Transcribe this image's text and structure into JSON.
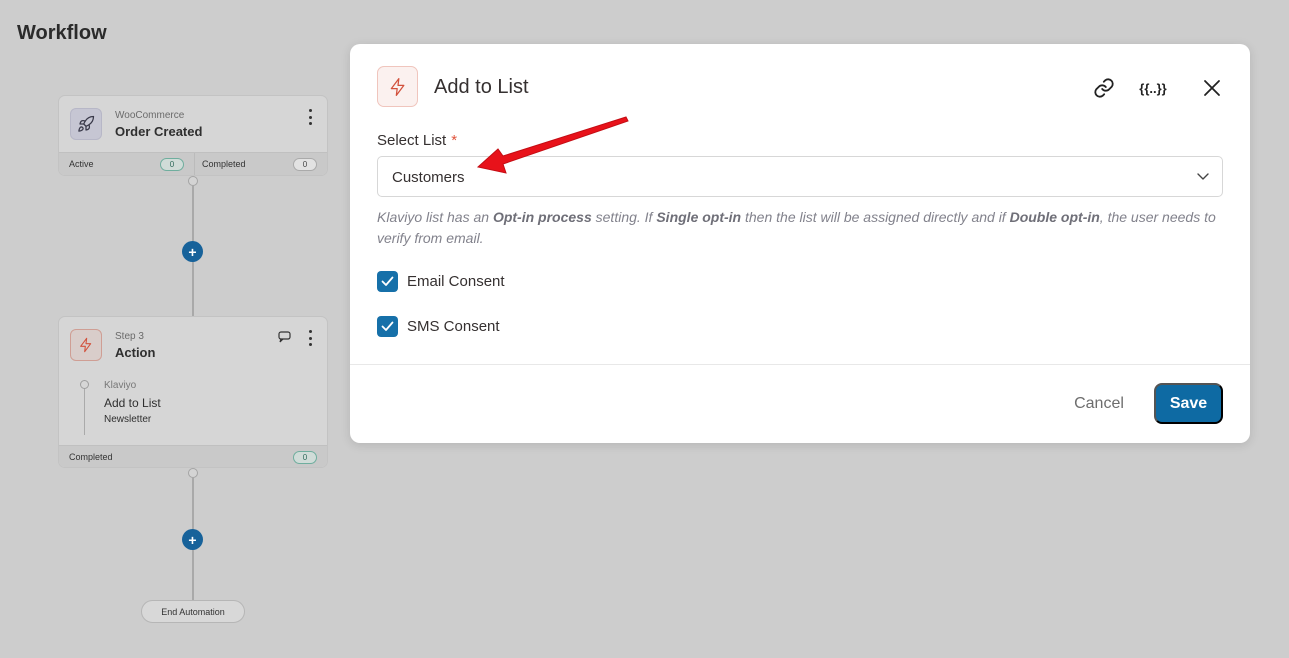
{
  "page": {
    "title": "Workflow"
  },
  "workflow": {
    "trigger": {
      "app": "WooCommerce",
      "title": "Order Created",
      "stats": [
        {
          "label": "Active",
          "value": "0"
        },
        {
          "label": "Completed",
          "value": "0"
        }
      ]
    },
    "action": {
      "step": "Step 3",
      "title": "Action",
      "app": "Klaviyo",
      "name": "Add to List",
      "list": "Newsletter",
      "stats": [
        {
          "label": "Completed",
          "value": "0"
        }
      ]
    },
    "add_step_glyph": "+",
    "end_label": "End Automation"
  },
  "modal": {
    "title": "Add to List",
    "header_icons": [
      "link-icon",
      "merge-tags-icon",
      "close-icon"
    ],
    "merge_tags_glyph": "{{..}}",
    "select_label": "Select List",
    "required_mark": "*",
    "select_value": "Customers",
    "hint": {
      "p1": "Klaviyo list has an ",
      "b1": "Opt-in process",
      "p2": " setting. If ",
      "b2": "Single opt-in",
      "p3": " then the list will be assigned directly and if ",
      "b3": "Double opt-in",
      "p4": ", the user needs to verify from email."
    },
    "checkboxes": [
      {
        "label": "Email Consent",
        "checked": true
      },
      {
        "label": "SMS Consent",
        "checked": true
      }
    ],
    "cancel_label": "Cancel",
    "save_label": "Save"
  },
  "colors": {
    "primary": "#0e6aa3",
    "accent_red": "#e0533b",
    "annotation_arrow": "#e8121a"
  }
}
